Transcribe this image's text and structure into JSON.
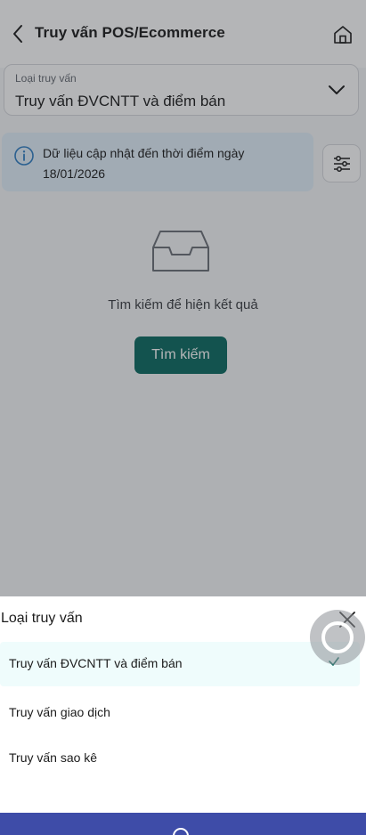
{
  "header": {
    "title": "Truy vấn POS/Ecommerce"
  },
  "query_select": {
    "label": "Loại truy vấn",
    "value": "Truy vấn ĐVCNTT và điểm bán"
  },
  "info": {
    "text": "Dữ liệu cập nhật đến thời điểm ngày 18/01/2026"
  },
  "empty_state": {
    "text": "Tìm kiếm để hiện kết quả"
  },
  "search_button": {
    "label": "Tìm kiếm"
  },
  "sheet": {
    "title": "Loại truy vấn",
    "options": [
      {
        "label": "Truy vấn ĐVCNTT và điểm bán",
        "selected": true
      },
      {
        "label": "Truy vấn giao dịch",
        "selected": false
      },
      {
        "label": "Truy vấn sao kê",
        "selected": false
      }
    ]
  },
  "colors": {
    "primary": "#0b6b61",
    "info_background": "#e3f0fb",
    "selected_option_background": "#effcfc",
    "bottom_bar": "#3e4ca8"
  },
  "icons": {
    "back": "chevron-left-icon",
    "home": "home-icon",
    "dropdown": "chevron-down-icon",
    "info": "info-icon",
    "filter": "sliders-icon",
    "empty": "inbox-icon",
    "close": "close-icon",
    "check": "check-icon"
  }
}
